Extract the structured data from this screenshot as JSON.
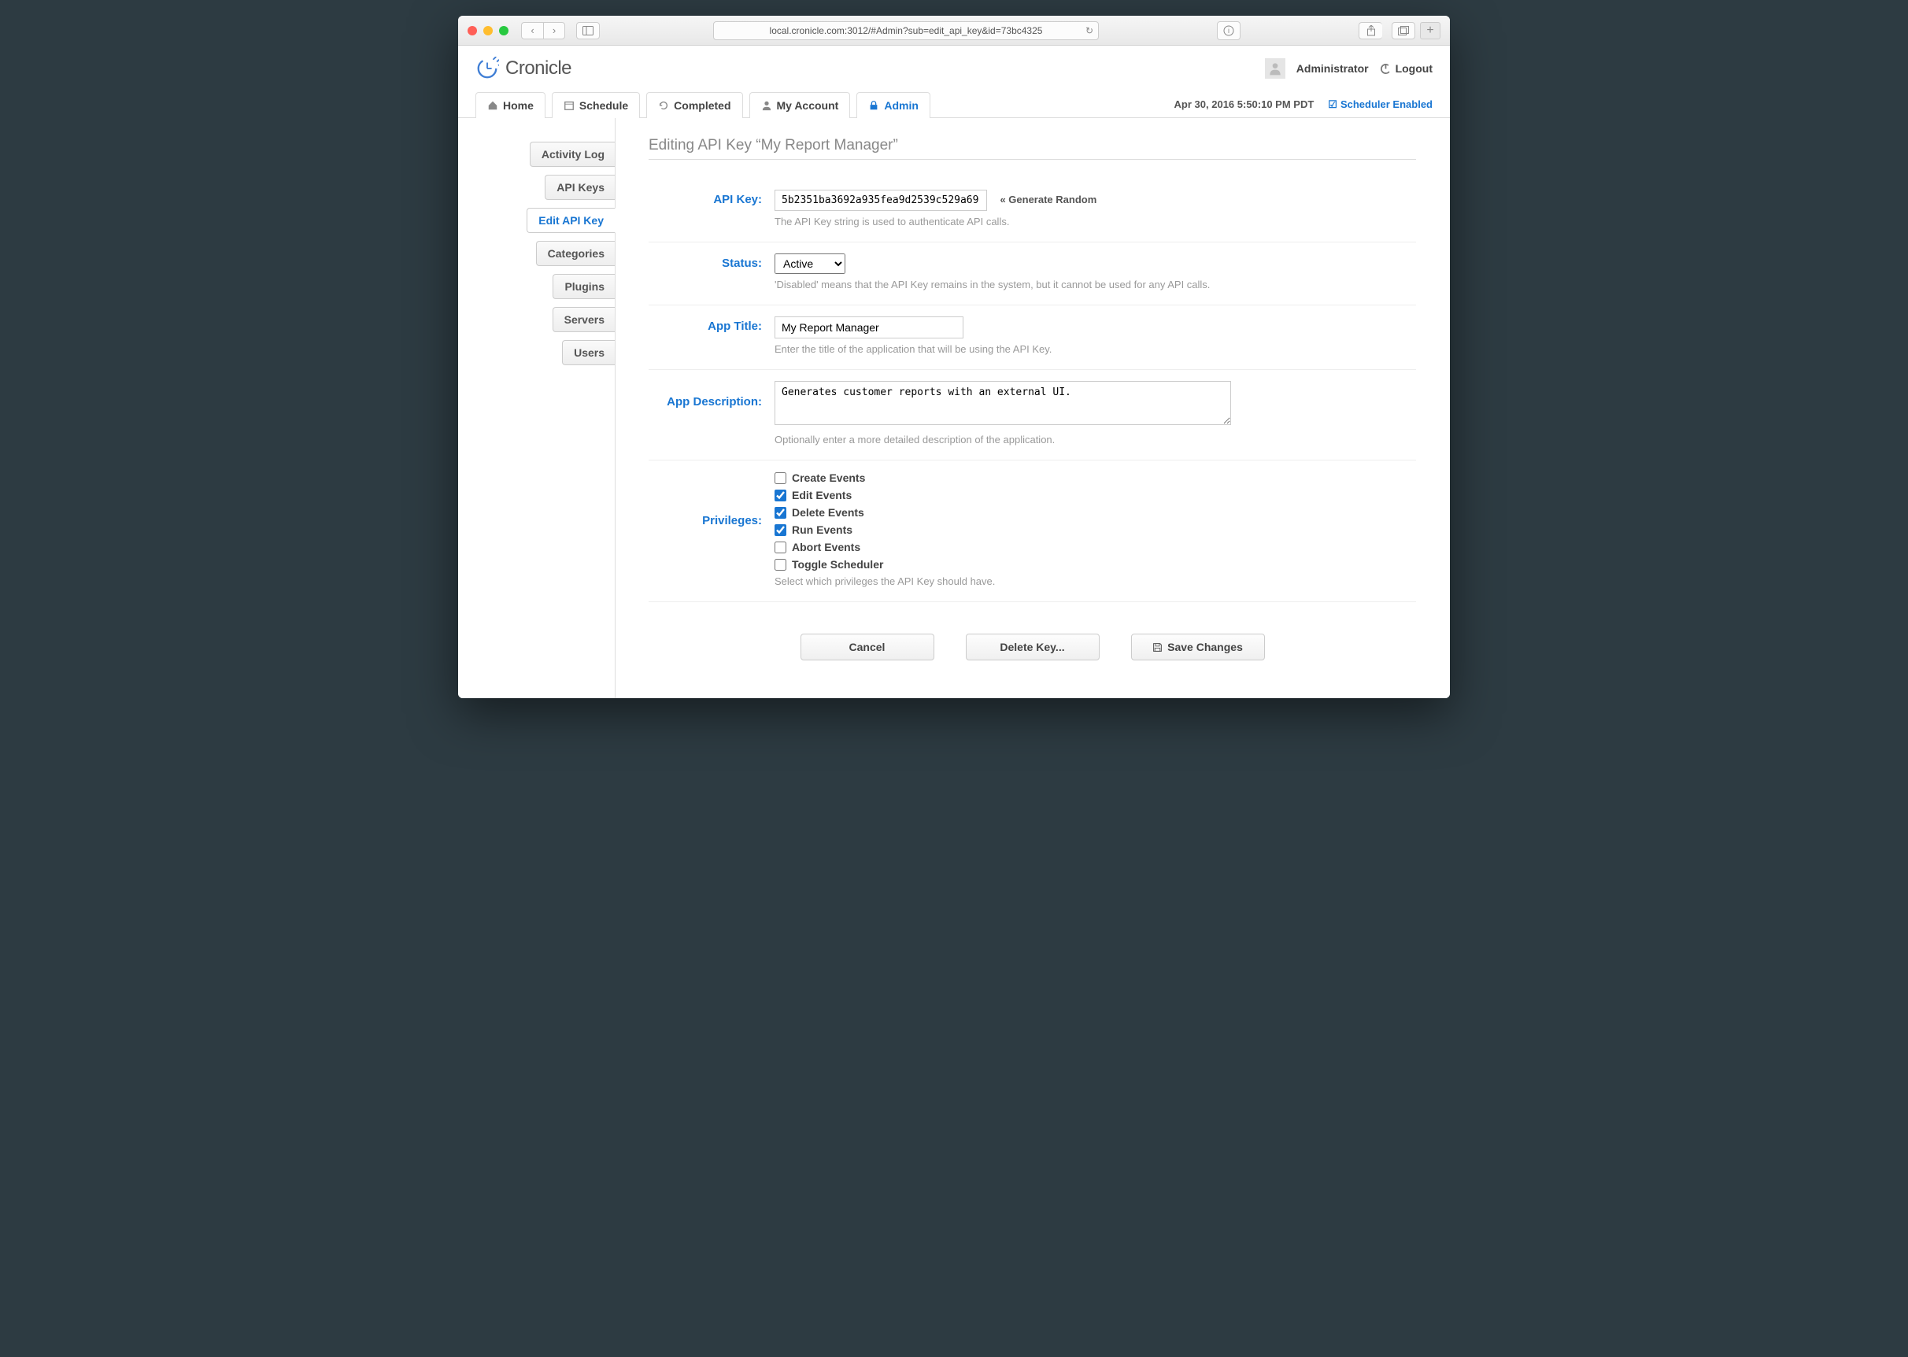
{
  "browser": {
    "url": "local.cronicle.com:3012/#Admin?sub=edit_api_key&id=73bc4325"
  },
  "header": {
    "app_name": "Cronicle",
    "user": "Administrator",
    "logout": "Logout"
  },
  "top_tabs": {
    "home": "Home",
    "schedule": "Schedule",
    "completed": "Completed",
    "my_account": "My Account",
    "admin": "Admin"
  },
  "toolbar": {
    "timestamp": "Apr 30, 2016 5:50:10 PM PDT",
    "scheduler_label": "Scheduler Enabled"
  },
  "sidebar": {
    "activity_log": "Activity Log",
    "api_keys": "API Keys",
    "edit_api_key": "Edit API Key",
    "categories": "Categories",
    "plugins": "Plugins",
    "servers": "Servers",
    "users": "Users"
  },
  "page": {
    "title": "Editing API Key “My Report Manager”"
  },
  "form": {
    "api_key": {
      "label": "API Key:",
      "value": "5b2351ba3692a935fea9d2539c529a69",
      "generate": "« Generate Random",
      "help": "The API Key string is used to authenticate API calls."
    },
    "status": {
      "label": "Status:",
      "value": "Active",
      "help": "'Disabled' means that the API Key remains in the system, but it cannot be used for any API calls."
    },
    "app_title": {
      "label": "App Title:",
      "value": "My Report Manager",
      "help": "Enter the title of the application that will be using the API Key."
    },
    "app_desc": {
      "label": "App Description:",
      "value": "Generates customer reports with an external UI.",
      "help": "Optionally enter a more detailed description of the application."
    },
    "privs": {
      "label": "Privileges:",
      "create": "Create Events",
      "edit": "Edit Events",
      "delete": "Delete Events",
      "run": "Run Events",
      "abort": "Abort Events",
      "toggle": "Toggle Scheduler",
      "help": "Select which privileges the API Key should have."
    }
  },
  "buttons": {
    "cancel": "Cancel",
    "delete": "Delete Key...",
    "save": "Save Changes"
  }
}
